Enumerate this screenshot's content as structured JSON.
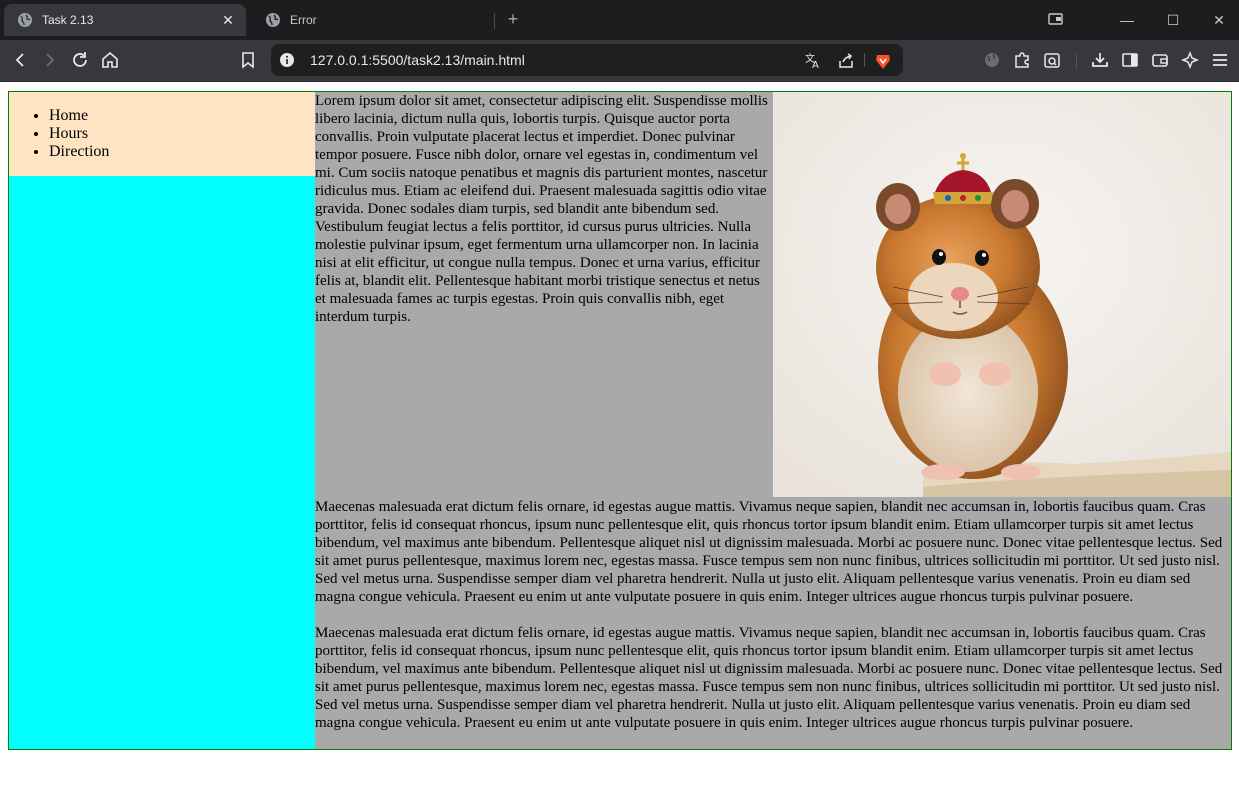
{
  "browser": {
    "tabs": [
      {
        "title": "Task 2.13",
        "active": true
      },
      {
        "title": "Error",
        "active": false
      }
    ],
    "url": "127.0.0.1:5500/task2.13/main.html",
    "icons": {
      "back": "arrow-left-icon",
      "forward": "arrow-right-icon",
      "reload": "reload-icon",
      "home": "home-icon",
      "bookmark": "bookmark-icon",
      "site_info": "info-icon",
      "translate": "translate-icon",
      "share": "share-icon",
      "brave_shields": "brave-lion-icon",
      "vpn": "globe-icon",
      "extensions": "puzzle-icon",
      "search_tabs": "tab-search-icon",
      "downloads": "download-icon",
      "sidebar": "sidebar-icon",
      "wallet": "wallet-icon",
      "leo": "leo-ai-icon",
      "menu": "hamburger-menu-icon"
    }
  },
  "page": {
    "nav": {
      "items": [
        "Home",
        "Hours",
        "Direction"
      ]
    },
    "paragraph1": "Lorem ipsum dolor sit amet, consectetur adipiscing elit. Suspendisse mollis libero lacinia, dictum nulla quis, lobortis turpis. Quisque auctor porta convallis. Proin vulputate placerat lectus et imperdiet. Donec pulvinar tempor posuere. Fusce nibh dolor, ornare vel egestas in, condimentum vel mi. Cum sociis natoque penatibus et magnis dis parturient montes, nascetur ridiculus mus. Etiam ac eleifend dui. Praesent malesuada sagittis odio vitae gravida. Donec sodales diam turpis, sed blandit ante bibendum sed. Vestibulum feugiat lectus a felis porttitor, id cursus purus ultricies. Nulla molestie pulvinar ipsum, eget fermentum urna ullamcorper non. In lacinia nisi at elit efficitur, ut congue nulla tempus. Donec et urna varius, efficitur felis at, blandit elit. Pellentesque habitant morbi tristique senectus et netus et malesuada fames ac turpis egestas. Proin quis convallis nibh, eget interdum turpis.",
    "paragraph2": "Maecenas malesuada erat dictum felis ornare, id egestas augue mattis. Vivamus neque sapien, blandit nec accumsan in, lobortis faucibus quam. Cras porttitor, felis id consequat rhoncus, ipsum nunc pellentesque elit, quis rhoncus tortor ipsum blandit enim. Etiam ullamcorper turpis sit amet lectus bibendum, vel maximus ante bibendum. Pellentesque aliquet nisl ut dignissim malesuada. Morbi ac posuere nunc. Donec vitae pellentesque lectus. Sed sit amet purus pellentesque, maximus lorem nec, egestas massa. Fusce tempus sem non nunc finibus, ultrices sollicitudin mi porttitor. Ut sed justo nisl. Sed vel metus urna. Suspendisse semper diam vel pharetra hendrerit. Nulla ut justo elit. Aliquam pellentesque varius venenatis. Proin eu diam sed magna congue vehicula. Praesent eu enim ut ante vulputate posuere in quis enim. Integer ultrices augue rhoncus turpis pulvinar posuere.",
    "paragraph3": "Maecenas malesuada erat dictum felis ornare, id egestas augue mattis. Vivamus neque sapien, blandit nec accumsan in, lobortis faucibus quam. Cras porttitor, felis id consequat rhoncus, ipsum nunc pellentesque elit, quis rhoncus tortor ipsum blandit enim. Etiam ullamcorper turpis sit amet lectus bibendum, vel maximus ante bibendum. Pellentesque aliquet nisl ut dignissim malesuada. Morbi ac posuere nunc. Donec vitae pellentesque lectus. Sed sit amet purus pellentesque, maximus lorem nec, egestas massa. Fusce tempus sem non nunc finibus, ultrices sollicitudin mi porttitor. Ut sed justo nisl. Sed vel metus urna. Suspendisse semper diam vel pharetra hendrerit. Nulla ut justo elit. Aliquam pellentesque varius venenatis. Proin eu diam sed magna congue vehicula. Praesent eu enim ut ante vulputate posuere in quis enim. Integer ultrices augue rhoncus turpis pulvinar posuere.",
    "image": {
      "subject": "hamster-with-crown-photo"
    },
    "colors": {
      "nav_bg": "#ffe4c4",
      "sidebar_bg": "#00ffff",
      "main_bg": "#a9a9a9",
      "border": "#008000"
    }
  }
}
